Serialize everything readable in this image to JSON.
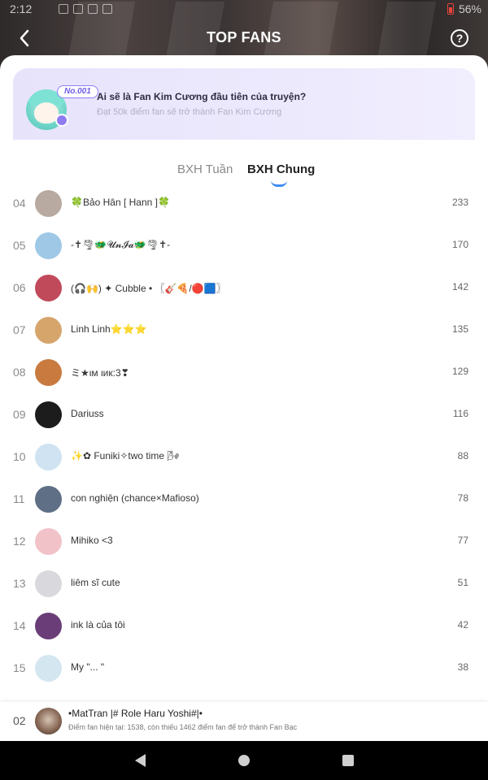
{
  "status": {
    "time": "2:12",
    "battery": "56%"
  },
  "header": {
    "title": "TOP FANS",
    "help_label": "?"
  },
  "banner": {
    "badge": "No.001",
    "title": "Ai sẽ là Fan Kim Cương đầu tiên của truyện?",
    "subtitle": "Đạt 50k điểm fan sẽ trở thành Fan Kim Cương"
  },
  "tabs": [
    {
      "label": "BXH Tuần",
      "active": false
    },
    {
      "label": "BXH Chung",
      "active": true
    }
  ],
  "fans": [
    {
      "rank": "04",
      "name": "🍀Bảo Hân [ Hann ]🍀",
      "score": "233",
      "avatar_color": "#b8aaa0"
    },
    {
      "rank": "05",
      "name": "-✝🌪🐲𝓤𝓷𝓘𝓪🐲🌪✝-",
      "score": "170",
      "avatar_color": "#9ec8e6"
    },
    {
      "rank": "06",
      "name": "(🎧🙌) ✦ Cubble • 〖🎸🍕/🔴🟦〗",
      "score": "142",
      "avatar_color": "#c0495a"
    },
    {
      "rank": "07",
      "name": "Linh Linh⭐⭐⭐",
      "score": "135",
      "avatar_color": "#d6a56c"
    },
    {
      "rank": "08",
      "name": "ミ★ιм ιик:3❣",
      "score": "129",
      "avatar_color": "#c97a3f"
    },
    {
      "rank": "09",
      "name": "Dariuss",
      "score": "116",
      "avatar_color": "#1c1c1c"
    },
    {
      "rank": "10",
      "name": "✨✿ Funiki✧two time 🌬",
      "score": "88",
      "avatar_color": "#cfe3f2"
    },
    {
      "rank": "11",
      "name": "con nghiện (chance×Mafioso)",
      "score": "78",
      "avatar_color": "#5e6f86"
    },
    {
      "rank": "12",
      "name": "Mihiko <3",
      "score": "77",
      "avatar_color": "#f1c3c8"
    },
    {
      "rank": "13",
      "name": "liêm sĩ cute",
      "score": "51",
      "avatar_color": "#d9d9dd"
    },
    {
      "rank": "14",
      "name": "ink là của tôi",
      "score": "42",
      "avatar_color": "#6a3d78"
    },
    {
      "rank": "15",
      "name": "My \"... \"",
      "score": "38",
      "avatar_color": "#d4e6f0"
    }
  ],
  "me": {
    "rank": "02",
    "name": "•MatTran |# Role Haru Yoshi#|•",
    "note": "Điểm fan hiện tại: 1538, còn thiếu 1462 điểm fan để trở thành Fan Bạc"
  }
}
